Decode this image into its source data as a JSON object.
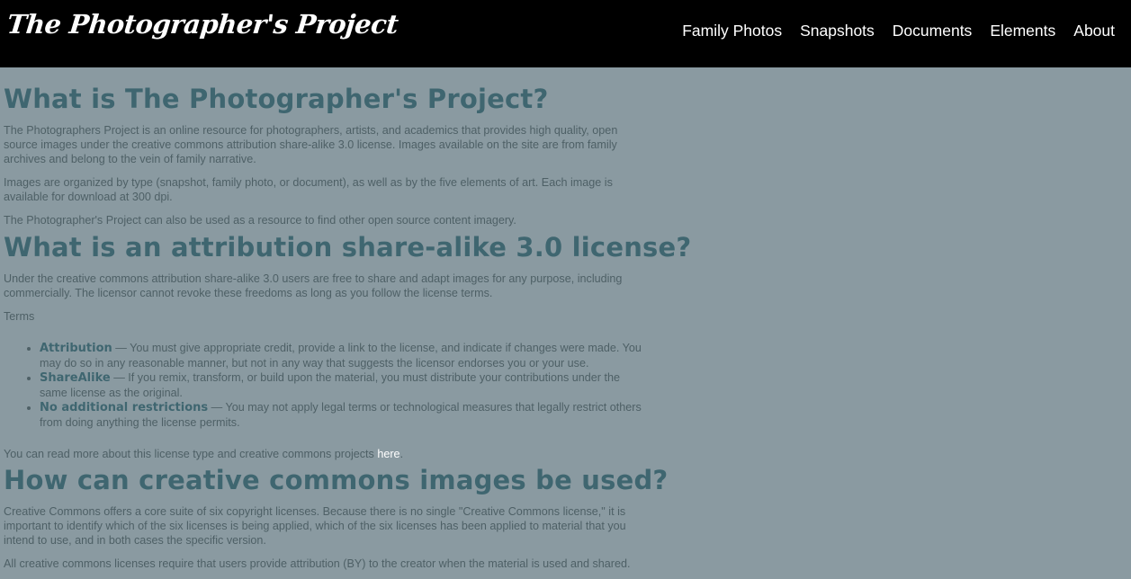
{
  "header": {
    "logo": "The Photographer's Project",
    "nav": [
      "Family Photos",
      "Snapshots",
      "Documents",
      "Elements",
      "About"
    ]
  },
  "sections": {
    "what_is": {
      "title": "What is The Photographer's Project?",
      "p1": "The Photographers Project is an online resource for photographers, artists, and academics that provides high quality, open source images under the creative commons attribution share-alike 3.0 license. Images available on the site are from family archives and belong to the vein of family narrative.",
      "p2": "Images are organized by type (snapshot, family photo, or document), as well as by the five elements of art. Each image is available for download at 300 dpi.",
      "p3": "The Photographer's Project can also be used as a resource to find other open source content imagery."
    },
    "license": {
      "title": "What is an attribution share-alike 3.0 license?",
      "p1": "Under the creative commons attribution share-alike 3.0 users are free to share and adapt images for any purpose, including commercially. The licensor cannot revoke these freedoms as long as you follow the license terms.",
      "terms_label": "Terms",
      "terms": [
        {
          "name": "Attribution",
          "text": " — You must give appropriate credit, provide a link to the license, and indicate if changes were made. You may do so in any reasonable manner, but not in any way that suggests the licensor endorses you or your use."
        },
        {
          "name": "ShareAlike",
          "text": " — If you remix, transform, or build upon the material, you must distribute your contributions under the same license as the original."
        },
        {
          "name": "No additional restrictions",
          "text": " — You may not apply legal terms or technological measures that legally restrict others from doing anything the license permits."
        }
      ],
      "read_more": "You can read more about this license type and creative commons projects ",
      "read_more_link": "here",
      "read_more_end": "."
    },
    "how_used": {
      "title": "How can creative commons images be used?",
      "p1": "Creative Commons offers a core suite of six copyright licenses. Because there is no single \"Creative Commons license,\" it is important to identify which of the six licenses is being applied, which of the six licenses has been applied to material that you intend to use, and in both cases the specific version.",
      "p2": "All creative commons licenses require that users provide attribution (BY) to the creator when the material is used and shared."
    }
  },
  "colors": {
    "background": "#8a9aa1",
    "header": "#000000",
    "heading": "#3f6670",
    "text": "#4e6066",
    "link": "#ffffff"
  }
}
